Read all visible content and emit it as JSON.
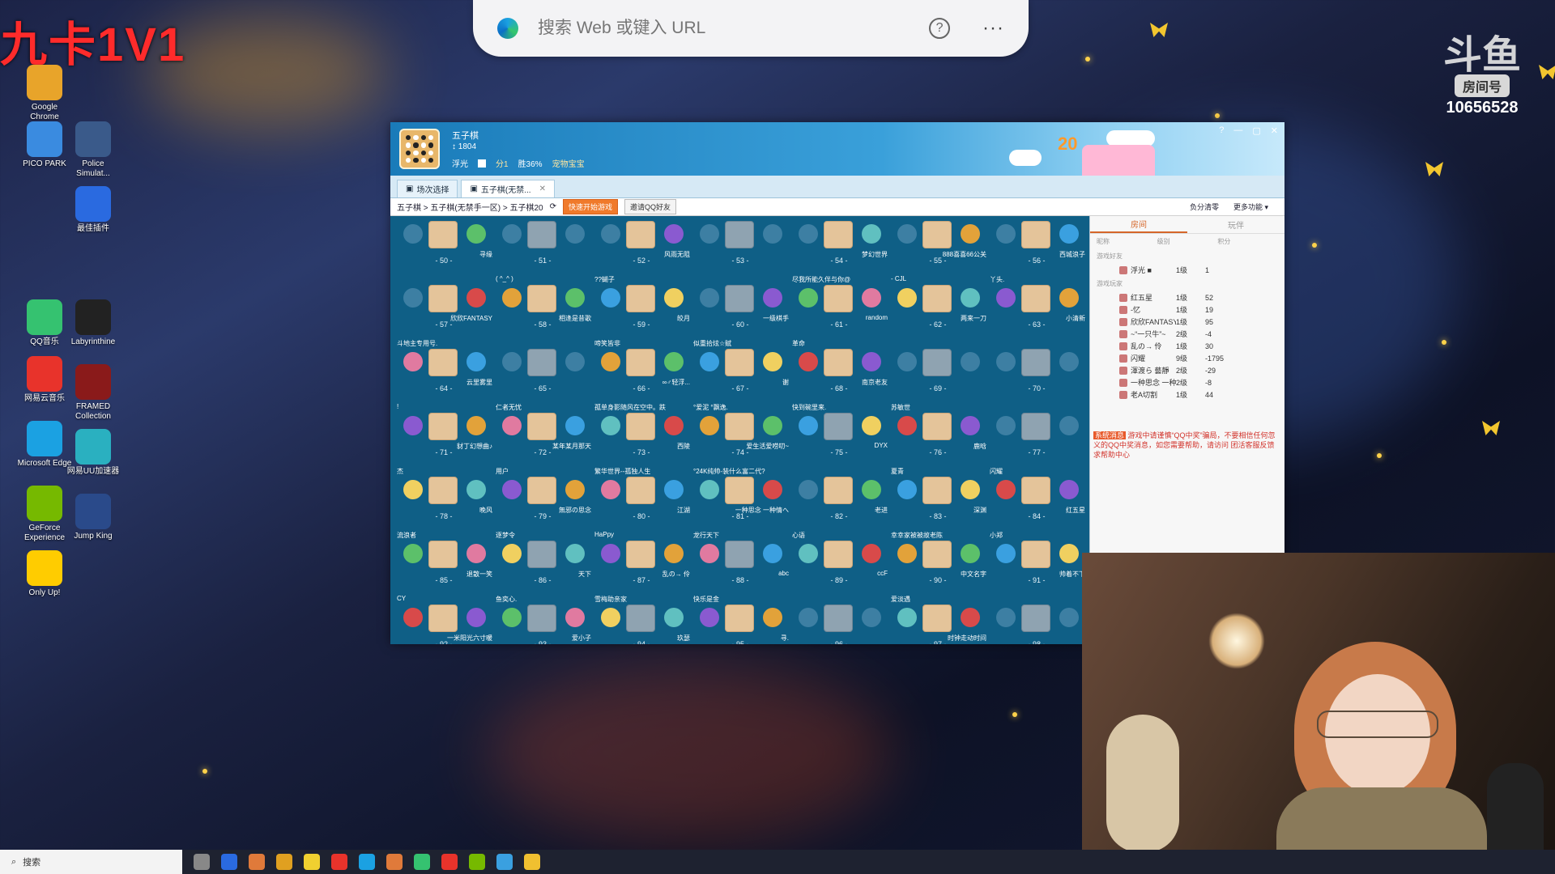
{
  "stream": {
    "overlay_title": "九卡1V1",
    "platform_room_label": "房间号",
    "room_number": "10656528"
  },
  "browser": {
    "placeholder": "搜索 Web 或键入 URL",
    "help": "?",
    "more": "···"
  },
  "desktop_icons": [
    {
      "label": "Google Chrome",
      "color": "#e8a42a"
    },
    {
      "label": "PICO PARK",
      "color": "#3a8be0"
    },
    {
      "label": "QQ音乐",
      "color": "#35c270"
    },
    {
      "label": "网易云音乐",
      "color": "#e8332b"
    },
    {
      "label": "Microsoft Edge",
      "color": "#1ba1e2"
    },
    {
      "label": "GeForce Experience",
      "color": "#76b900"
    },
    {
      "label": "Only Up!",
      "color": "#ffcc00"
    },
    {
      "label": "Police Simulat...",
      "color": "#3a5a8a"
    },
    {
      "label": "最佳插件",
      "color": "#2a6ae0"
    },
    {
      "label": "Labyrinthine",
      "color": "#222222"
    },
    {
      "label": "FRAMED Collection",
      "color": "#8a1a1a"
    },
    {
      "label": "网易UU加速器",
      "color": "#2ab0c0"
    },
    {
      "label": "Jump King",
      "color": "#2a4a8a"
    }
  ],
  "game": {
    "title": "五子棋",
    "score": "1804",
    "username": "浮光",
    "stats": [
      "分1",
      "胜36%",
      "宠物宝宝"
    ],
    "banner_num": "20",
    "controls": [
      "?",
      "—",
      "▢",
      "✕"
    ],
    "tabs": [
      {
        "label": "场次选择",
        "active": false
      },
      {
        "label": "五子棋(无禁...",
        "active": true
      }
    ],
    "breadcrumb": "五子棋 > 五子棋(无禁手一区) > 五子棋20",
    "quick_start": "快速开始游戏",
    "invite": "邀请QQ好友",
    "toolbar_right": [
      "负分清零",
      "更多功能 ▾"
    ],
    "tables": [
      {
        "num": "- 50 -",
        "left": "",
        "right": "寻缘",
        "filled": true
      },
      {
        "num": "- 51 -",
        "left": "",
        "right": "",
        "filled": false
      },
      {
        "num": "- 52 -",
        "left": "",
        "right": "风雨无阻",
        "filled": true
      },
      {
        "num": "- 53 -",
        "left": "",
        "right": "",
        "filled": false
      },
      {
        "num": "- 54 -",
        "left": "",
        "right": "梦幻世界",
        "filled": true
      },
      {
        "num": "- 55 -",
        "left": "",
        "right": "888喜喜66公关",
        "filled": true
      },
      {
        "num": "- 56 -",
        "left": "",
        "right": "西城浪子",
        "filled": true
      },
      {
        "num": "- 57 -",
        "left": "",
        "right": "欣欣FANTASY",
        "filled": true
      },
      {
        "num": "- 58 -",
        "left": "( ^_^ )",
        "right": "相逢是昔歌",
        "filled": true
      },
      {
        "num": "- 59 -",
        "left": "??蝴子",
        "right": "皎月",
        "filled": true
      },
      {
        "num": "- 60 -",
        "left": "",
        "right": "一级棋手",
        "filled": false
      },
      {
        "num": "- 61 -",
        "left": "尽我所能久伴与你@",
        "right": "random",
        "filled": true
      },
      {
        "num": "- 62 -",
        "left": "- CJL",
        "right": "两来一刀",
        "filled": true
      },
      {
        "num": "- 63 -",
        "left": "丫头.",
        "right": "小清新",
        "filled": true
      },
      {
        "num": "- 64 -",
        "left": "斗地主专用号.",
        "right": "云里雾里",
        "filled": true
      },
      {
        "num": "- 65 -",
        "left": "",
        "right": "",
        "filled": false
      },
      {
        "num": "- 66 -",
        "left": "啼笑皆非",
        "right": "∞♂轻浮...",
        "filled": true
      },
      {
        "num": "- 67 -",
        "left": "似重拾炫☆赋",
        "right": "谢",
        "filled": true
      },
      {
        "num": "- 68 -",
        "left": "革命",
        "right": "南京老友",
        "filled": true
      },
      {
        "num": "- 69 -",
        "left": "",
        "right": "",
        "filled": false
      },
      {
        "num": "- 70 -",
        "left": "",
        "right": "",
        "filled": false
      },
      {
        "num": "- 71 -",
        "left": "!",
        "right": "豺丁幻想曲♪",
        "filled": true
      },
      {
        "num": "- 72 -",
        "left": "仁者无忧",
        "right": "某年某月那天",
        "filled": true
      },
      {
        "num": "- 73 -",
        "left": "孤单身影随风在空中。跌",
        "right": "西陵",
        "filled": true
      },
      {
        "num": "- 74 -",
        "left": "°爱泥 °飘逸.",
        "right": "爱生活爱唠叨~",
        "filled": true
      },
      {
        "num": "- 75 -",
        "left": "快到碗里来.",
        "right": "DYX",
        "filled": false
      },
      {
        "num": "- 76 -",
        "left": "苏敏世",
        "right": "鹿晗",
        "filled": true
      },
      {
        "num": "- 77 -",
        "left": "",
        "right": "",
        "filled": false
      },
      {
        "num": "- 78 -",
        "left": "杰",
        "right": "晚风",
        "filled": true
      },
      {
        "num": "- 79 -",
        "left": "用户",
        "right": "無邪の思念",
        "filled": true
      },
      {
        "num": "- 80 -",
        "left": "繁华世界--孤独人生",
        "right": "江湖",
        "filled": true
      },
      {
        "num": "- 81 -",
        "left": "°24K纯帅-装什么富二代?",
        "right": "一种思念 一种情へ",
        "filled": true
      },
      {
        "num": "- 82 -",
        "left": "",
        "right": "老进",
        "filled": true
      },
      {
        "num": "- 83 -",
        "left": "夏青",
        "right": "深渊",
        "filled": true
      },
      {
        "num": "- 84 -",
        "left": "闪耀",
        "right": "红五星",
        "filled": true
      },
      {
        "num": "- 85 -",
        "left": "流浪者",
        "right": "退散一笑",
        "filled": true
      },
      {
        "num": "- 86 -",
        "left": "逐梦令",
        "right": "天下",
        "filled": false
      },
      {
        "num": "- 87 -",
        "left": "HaPpy",
        "right": "乱の→ 伶",
        "filled": true
      },
      {
        "num": "- 88 -",
        "left": "龙行天下",
        "right": "abc",
        "filled": false
      },
      {
        "num": "- 89 -",
        "left": "心语",
        "right": "ccF",
        "filled": true
      },
      {
        "num": "- 90 -",
        "left": "幸幸家被被故老陈",
        "right": "中文名字",
        "filled": true
      },
      {
        "num": "- 91 -",
        "left": "小郑",
        "right": "帅着不下",
        "filled": true
      },
      {
        "num": "- 92 -",
        "left": "CY",
        "right": "一米阳光六寸暖",
        "filled": true
      },
      {
        "num": "- 93 -",
        "left": "鱼奕心.",
        "right": "爱小子",
        "filled": false
      },
      {
        "num": "- 94 -",
        "left": "雪梅助亲家",
        "right": "玖瑟",
        "filled": false
      },
      {
        "num": "- 95 -",
        "left": "快乐是金",
        "right": "寻.",
        "filled": true
      },
      {
        "num": "- 96 -",
        "left": "",
        "right": "",
        "filled": false
      },
      {
        "num": "- 97 -",
        "left": "爱淡遇",
        "right": "时钟走动时间",
        "filled": true
      },
      {
        "num": "- 98 -",
        "left": "",
        "right": "",
        "filled": false
      }
    ],
    "side": {
      "tabs": [
        "房间",
        "玩伴"
      ],
      "headers": [
        "昵称",
        "级别",
        "积分"
      ],
      "friends_group": "游戏好友",
      "friends": [
        {
          "name": "浮光 ■",
          "level": "1级",
          "score": "1"
        }
      ],
      "players_group": "游戏玩家",
      "players": [
        {
          "name": "红五星",
          "level": "1级",
          "score": "52"
        },
        {
          "name": "-忆",
          "level": "1级",
          "score": "19"
        },
        {
          "name": "欣欣FANTASY",
          "level": "1级",
          "score": "95"
        },
        {
          "name": "~“一只牛”~",
          "level": "2级",
          "score": "-4"
        },
        {
          "name": "乱の→ 伶",
          "level": "1级",
          "score": "30"
        },
        {
          "name": "闪耀",
          "level": "9级",
          "score": "-1795"
        },
        {
          "name": "渾渡ら 藝靜",
          "level": "2级",
          "score": "-29"
        },
        {
          "name": "一种思念 一种...",
          "level": "2级",
          "score": "-8"
        },
        {
          "name": "老A切割",
          "level": "1级",
          "score": "44"
        }
      ],
      "notice_tag": "系统消息",
      "notice": "游戏中请谨慎“QQ中奖”骗局，不要相信任何忽义的QQ中奖消息，如您需要帮助，请访问 团活客服反馈求帮助中心"
    }
  },
  "taskbar": {
    "search": "搜索"
  }
}
